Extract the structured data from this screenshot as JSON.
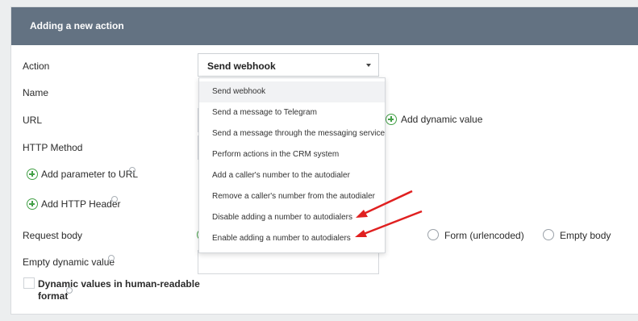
{
  "panel": {
    "title": "Adding a new action"
  },
  "form": {
    "action_label": "Action",
    "action_value": "Send webhook",
    "name_label": "Name",
    "url_label": "URL",
    "add_dynamic_value": "Add dynamic value",
    "http_method_label": "HTTP Method",
    "add_parameter_to_url": "Add parameter to URL",
    "add_http_header": "Add HTTP Header",
    "request_body_label": "Request body",
    "body_option_form": "Form (urlencoded)",
    "body_option_empty": "Empty body",
    "empty_dynamic_value_label": "Empty dynamic value",
    "human_readable_line1": "Dynamic values in human-readable",
    "human_readable_line2": "format"
  },
  "dropdown": {
    "items": [
      "Send webhook",
      "Send a message to Telegram",
      "Send a message through the messaging service",
      "Perform actions in the CRM system",
      "Add a caller's number to the autodialer",
      "Remove a caller's number from the autodialer",
      "Disable adding a number to autodialers",
      "Enable adding a number to autodialers"
    ],
    "selected_index": 0
  },
  "colors": {
    "header": "#637282",
    "accent": "#43a047",
    "annotation": "#e02020"
  }
}
